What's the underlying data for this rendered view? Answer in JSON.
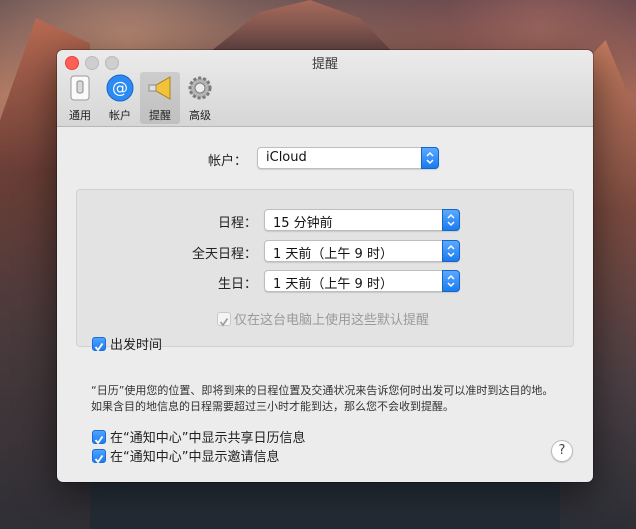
{
  "window": {
    "title": "提醒"
  },
  "toolbar": {
    "items": [
      {
        "label": "通用",
        "icon": "switch-icon"
      },
      {
        "label": "帐户",
        "icon": "at-icon"
      },
      {
        "label": "提醒",
        "icon": "megaphone-icon",
        "selected": true
      },
      {
        "label": "高级",
        "icon": "gear-icon"
      }
    ]
  },
  "account": {
    "label": "帐户：",
    "value": "iCloud"
  },
  "defaults": {
    "event": {
      "label": "日程：",
      "value": "15 分钟前"
    },
    "all_day": {
      "label": "全天日程：",
      "value": "1 天前（上午 9 时）"
    },
    "birthday": {
      "label": "生日：",
      "value": "1 天前（上午 9 时）"
    },
    "only_this_computer": {
      "label": "仅在这台电脑上使用这些默认提醒",
      "checked": true,
      "disabled": true
    }
  },
  "departure": {
    "label": "出发时间",
    "checked": true,
    "description": "“日历”使用您的位置、即将到来的日程位置及交通状况来告诉您何时出发可以准时到达目的地。如果含目的地信息的日程需要超过三小时才能到达，那么您不会收到提醒。"
  },
  "notification_center": {
    "shared": {
      "label": "在“通知中心”中显示共享日历信息",
      "checked": true
    },
    "invites": {
      "label": "在“通知中心”中显示邀请信息",
      "checked": true
    }
  },
  "help": {
    "label": "?"
  },
  "colors": {
    "accent": "#1f7cf0",
    "close": "#ff5f57"
  }
}
